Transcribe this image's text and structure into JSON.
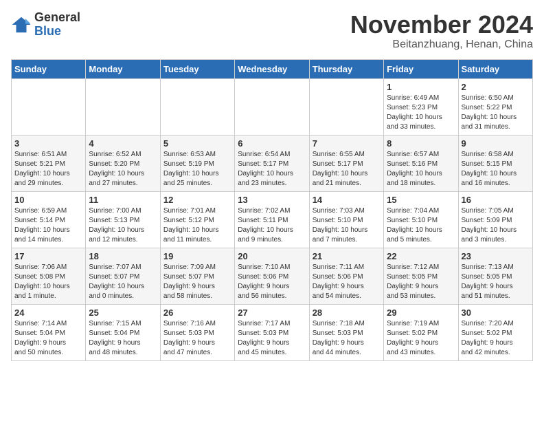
{
  "logo": {
    "general": "General",
    "blue": "Blue"
  },
  "title": "November 2024",
  "location": "Beitanzhuang, Henan, China",
  "weekdays": [
    "Sunday",
    "Monday",
    "Tuesday",
    "Wednesday",
    "Thursday",
    "Friday",
    "Saturday"
  ],
  "weeks": [
    [
      {
        "day": "",
        "info": ""
      },
      {
        "day": "",
        "info": ""
      },
      {
        "day": "",
        "info": ""
      },
      {
        "day": "",
        "info": ""
      },
      {
        "day": "",
        "info": ""
      },
      {
        "day": "1",
        "info": "Sunrise: 6:49 AM\nSunset: 5:23 PM\nDaylight: 10 hours\nand 33 minutes."
      },
      {
        "day": "2",
        "info": "Sunrise: 6:50 AM\nSunset: 5:22 PM\nDaylight: 10 hours\nand 31 minutes."
      }
    ],
    [
      {
        "day": "3",
        "info": "Sunrise: 6:51 AM\nSunset: 5:21 PM\nDaylight: 10 hours\nand 29 minutes."
      },
      {
        "day": "4",
        "info": "Sunrise: 6:52 AM\nSunset: 5:20 PM\nDaylight: 10 hours\nand 27 minutes."
      },
      {
        "day": "5",
        "info": "Sunrise: 6:53 AM\nSunset: 5:19 PM\nDaylight: 10 hours\nand 25 minutes."
      },
      {
        "day": "6",
        "info": "Sunrise: 6:54 AM\nSunset: 5:17 PM\nDaylight: 10 hours\nand 23 minutes."
      },
      {
        "day": "7",
        "info": "Sunrise: 6:55 AM\nSunset: 5:17 PM\nDaylight: 10 hours\nand 21 minutes."
      },
      {
        "day": "8",
        "info": "Sunrise: 6:57 AM\nSunset: 5:16 PM\nDaylight: 10 hours\nand 18 minutes."
      },
      {
        "day": "9",
        "info": "Sunrise: 6:58 AM\nSunset: 5:15 PM\nDaylight: 10 hours\nand 16 minutes."
      }
    ],
    [
      {
        "day": "10",
        "info": "Sunrise: 6:59 AM\nSunset: 5:14 PM\nDaylight: 10 hours\nand 14 minutes."
      },
      {
        "day": "11",
        "info": "Sunrise: 7:00 AM\nSunset: 5:13 PM\nDaylight: 10 hours\nand 12 minutes."
      },
      {
        "day": "12",
        "info": "Sunrise: 7:01 AM\nSunset: 5:12 PM\nDaylight: 10 hours\nand 11 minutes."
      },
      {
        "day": "13",
        "info": "Sunrise: 7:02 AM\nSunset: 5:11 PM\nDaylight: 10 hours\nand 9 minutes."
      },
      {
        "day": "14",
        "info": "Sunrise: 7:03 AM\nSunset: 5:10 PM\nDaylight: 10 hours\nand 7 minutes."
      },
      {
        "day": "15",
        "info": "Sunrise: 7:04 AM\nSunset: 5:10 PM\nDaylight: 10 hours\nand 5 minutes."
      },
      {
        "day": "16",
        "info": "Sunrise: 7:05 AM\nSunset: 5:09 PM\nDaylight: 10 hours\nand 3 minutes."
      }
    ],
    [
      {
        "day": "17",
        "info": "Sunrise: 7:06 AM\nSunset: 5:08 PM\nDaylight: 10 hours\nand 1 minute."
      },
      {
        "day": "18",
        "info": "Sunrise: 7:07 AM\nSunset: 5:07 PM\nDaylight: 10 hours\nand 0 minutes."
      },
      {
        "day": "19",
        "info": "Sunrise: 7:09 AM\nSunset: 5:07 PM\nDaylight: 9 hours\nand 58 minutes."
      },
      {
        "day": "20",
        "info": "Sunrise: 7:10 AM\nSunset: 5:06 PM\nDaylight: 9 hours\nand 56 minutes."
      },
      {
        "day": "21",
        "info": "Sunrise: 7:11 AM\nSunset: 5:06 PM\nDaylight: 9 hours\nand 54 minutes."
      },
      {
        "day": "22",
        "info": "Sunrise: 7:12 AM\nSunset: 5:05 PM\nDaylight: 9 hours\nand 53 minutes."
      },
      {
        "day": "23",
        "info": "Sunrise: 7:13 AM\nSunset: 5:05 PM\nDaylight: 9 hours\nand 51 minutes."
      }
    ],
    [
      {
        "day": "24",
        "info": "Sunrise: 7:14 AM\nSunset: 5:04 PM\nDaylight: 9 hours\nand 50 minutes."
      },
      {
        "day": "25",
        "info": "Sunrise: 7:15 AM\nSunset: 5:04 PM\nDaylight: 9 hours\nand 48 minutes."
      },
      {
        "day": "26",
        "info": "Sunrise: 7:16 AM\nSunset: 5:03 PM\nDaylight: 9 hours\nand 47 minutes."
      },
      {
        "day": "27",
        "info": "Sunrise: 7:17 AM\nSunset: 5:03 PM\nDaylight: 9 hours\nand 45 minutes."
      },
      {
        "day": "28",
        "info": "Sunrise: 7:18 AM\nSunset: 5:03 PM\nDaylight: 9 hours\nand 44 minutes."
      },
      {
        "day": "29",
        "info": "Sunrise: 7:19 AM\nSunset: 5:02 PM\nDaylight: 9 hours\nand 43 minutes."
      },
      {
        "day": "30",
        "info": "Sunrise: 7:20 AM\nSunset: 5:02 PM\nDaylight: 9 hours\nand 42 minutes."
      }
    ]
  ]
}
